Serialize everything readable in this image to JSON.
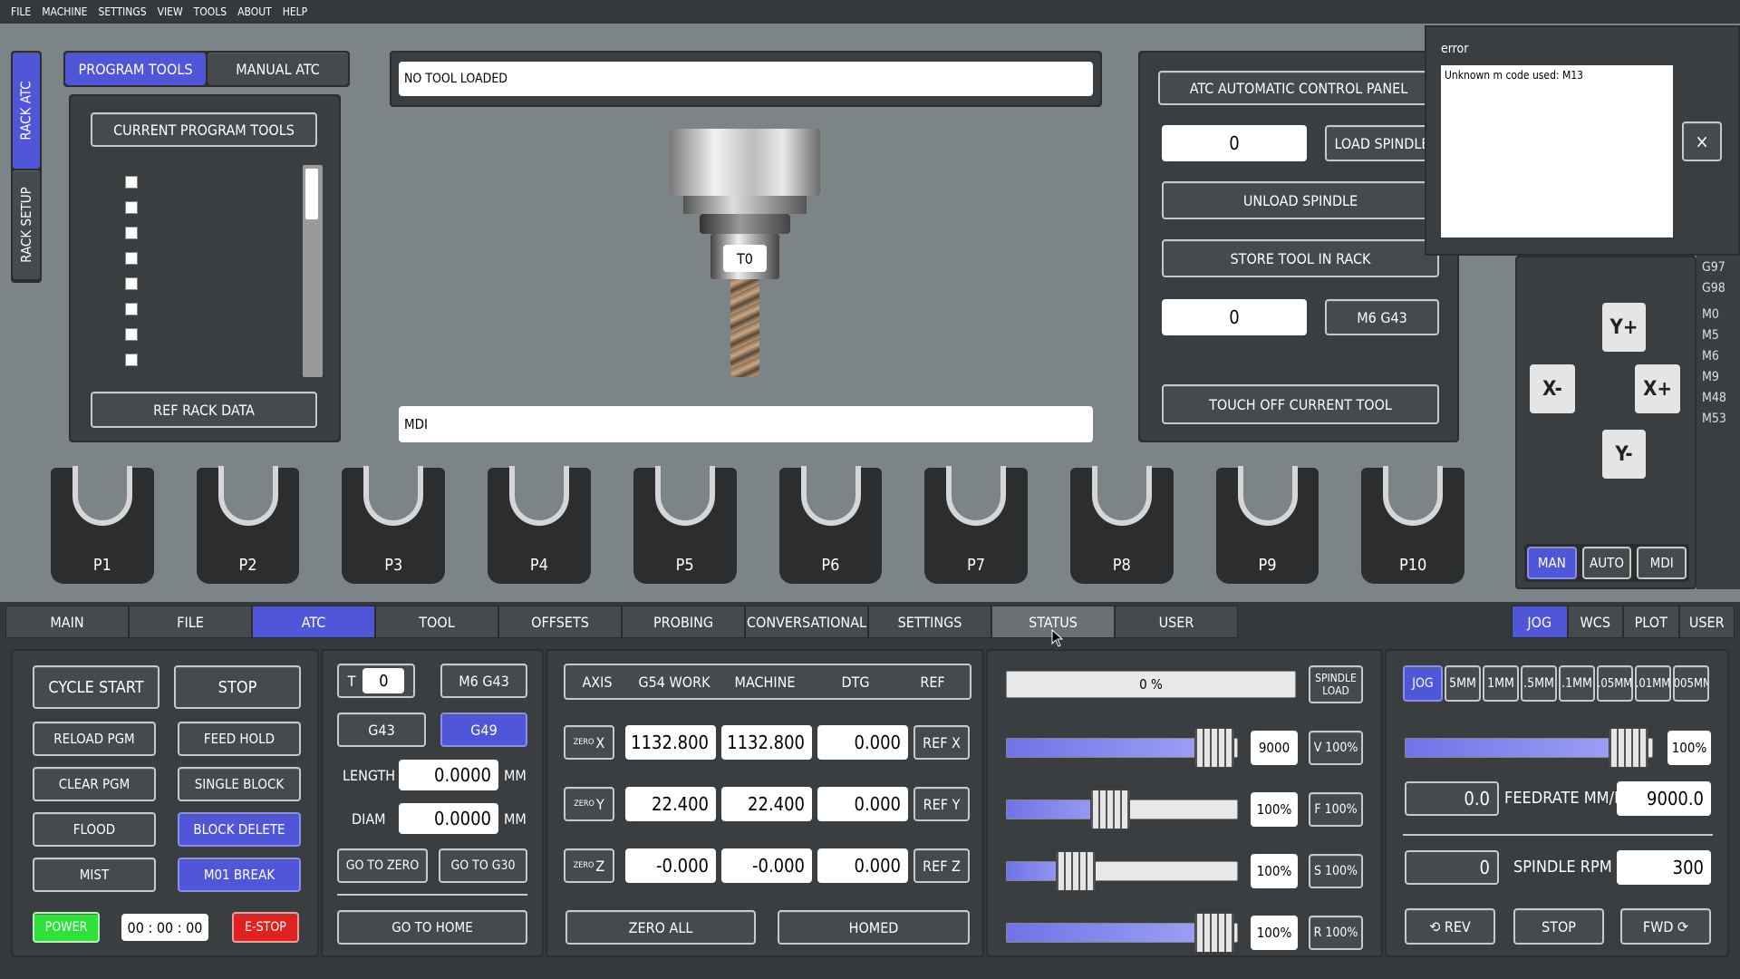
{
  "menu": [
    "FILE",
    "MACHINE",
    "SETTINGS",
    "VIEW",
    "TOOLS",
    "ABOUT",
    "HELP"
  ],
  "side_tabs": {
    "rack_atc": "RACK ATC",
    "rack_setup": "RACK SETUP"
  },
  "tool_tabs": {
    "program_tools": "PROGRAM TOOLS",
    "manual_atc": "MANUAL ATC"
  },
  "program_tools": {
    "title": "CURRENT PROGRAM TOOLS",
    "ref_button": "REF RACK DATA",
    "scroll_fraction": 0.12
  },
  "tool_display": {
    "no_tool": "NO TOOL LOADED",
    "tool_label": "T0",
    "mdi": "MDI"
  },
  "atc_panel": {
    "title": "ATC AUTOMATIC CONTROL PANEL",
    "tool_num_1": "0",
    "load_spindle": "LOAD SPINDLE",
    "unload_spindle": "UNLOAD SPINDLE",
    "store_tool": "STORE TOOL IN RACK",
    "tool_num_2": "0",
    "m6g43": "M6 G43",
    "touch_off": "TOUCH OFF CURRENT TOOL"
  },
  "error_dialog": {
    "title": "error",
    "message": "Unknown m code used: M13",
    "close": "×"
  },
  "jog": {
    "yplus": "Y+",
    "yminus": "Y-",
    "xplus": "X+",
    "xminus": "X-"
  },
  "gcodes": [
    "G97",
    "G98",
    "M0",
    "M5",
    "M6",
    "M9",
    "M48",
    "M53"
  ],
  "modes": [
    "MAN",
    "AUTO",
    "MDI"
  ],
  "pockets": [
    "P1",
    "P2",
    "P3",
    "P4",
    "P5",
    "P6",
    "P7",
    "P8",
    "P9",
    "P10"
  ],
  "main_tabs": [
    "MAIN",
    "FILE",
    "ATC",
    "TOOL",
    "OFFSETS",
    "PROBING",
    "CONVERSATIONAL",
    "SETTINGS",
    "STATUS",
    "USER"
  ],
  "right_tabs": [
    "JOG",
    "WCS",
    "PLOT",
    "USER"
  ],
  "controls": {
    "cycle_start": "CYCLE START",
    "stop": "STOP",
    "reload": "RELOAD PGM",
    "feed_hold": "FEED HOLD",
    "clear": "CLEAR PGM",
    "single_block": "SINGLE BLOCK",
    "flood": "FLOOD",
    "block_delete": "BLOCK DELETE",
    "mist": "MIST",
    "m01": "M01 BREAK",
    "power": "POWER",
    "timer": "00 : 00 : 00",
    "estop": "E-STOP"
  },
  "tool": {
    "t_label": "T",
    "t_value": "0",
    "m6g43": "M6 G43",
    "g43": "G43",
    "g49": "G49",
    "length_label": "LENGTH",
    "length": "0.0000",
    "diam_label": "DIAM",
    "diam": "0.0000",
    "unit": "MM",
    "go_zero": "GO TO ZERO",
    "go_g30": "GO TO G30",
    "go_home": "GO TO HOME"
  },
  "dro": {
    "headers": [
      "AXIS",
      "G54 WORK",
      "MACHINE",
      "DTG",
      "REF"
    ],
    "zero": "ZERO",
    "rows": [
      {
        "axis": "X",
        "work": "1132.800",
        "machine": "1132.800",
        "dtg": "0.000",
        "ref": "REF X"
      },
      {
        "axis": "Y",
        "work": "22.400",
        "machine": "22.400",
        "dtg": "0.000",
        "ref": "REF Y"
      },
      {
        "axis": "Z",
        "work": "-0.000",
        "machine": "-0.000",
        "dtg": "0.000",
        "ref": "REF Z"
      }
    ],
    "zero_all": "ZERO ALL",
    "homed": "HOMED"
  },
  "overrides": {
    "load": "0 %",
    "spindle_load": "SPINDLE LOAD",
    "rows": [
      {
        "value": "9000",
        "button": "V 100%",
        "fraction": 0.9
      },
      {
        "value": "100%",
        "button": "F 100%",
        "fraction": 0.45
      },
      {
        "value": "100%",
        "button": "S 100%",
        "fraction": 0.3
      },
      {
        "value": "100%",
        "button": "R 100%",
        "fraction": 0.9
      }
    ]
  },
  "jog_panel": {
    "increments": [
      "JOG",
      "5MM",
      "1MM",
      ".5MM",
      ".1MM",
      ".05MM",
      ".01MM",
      ".005MM"
    ],
    "jog_rate": "100%",
    "jog_fraction": 0.9,
    "feed_actual": "0.0",
    "feedrate_label": "FEEDRATE MM/M",
    "feed_set": "9000.0",
    "spindle_actual": "0",
    "spindle_label": "SPINDLE RPM",
    "spindle_set": "300",
    "rev": "⟲ REV",
    "stop": "STOP",
    "fwd": "FWD ⟳"
  },
  "colors": {
    "accent": "#5056d8",
    "power": "#2ee23a",
    "estop": "#e02121"
  }
}
